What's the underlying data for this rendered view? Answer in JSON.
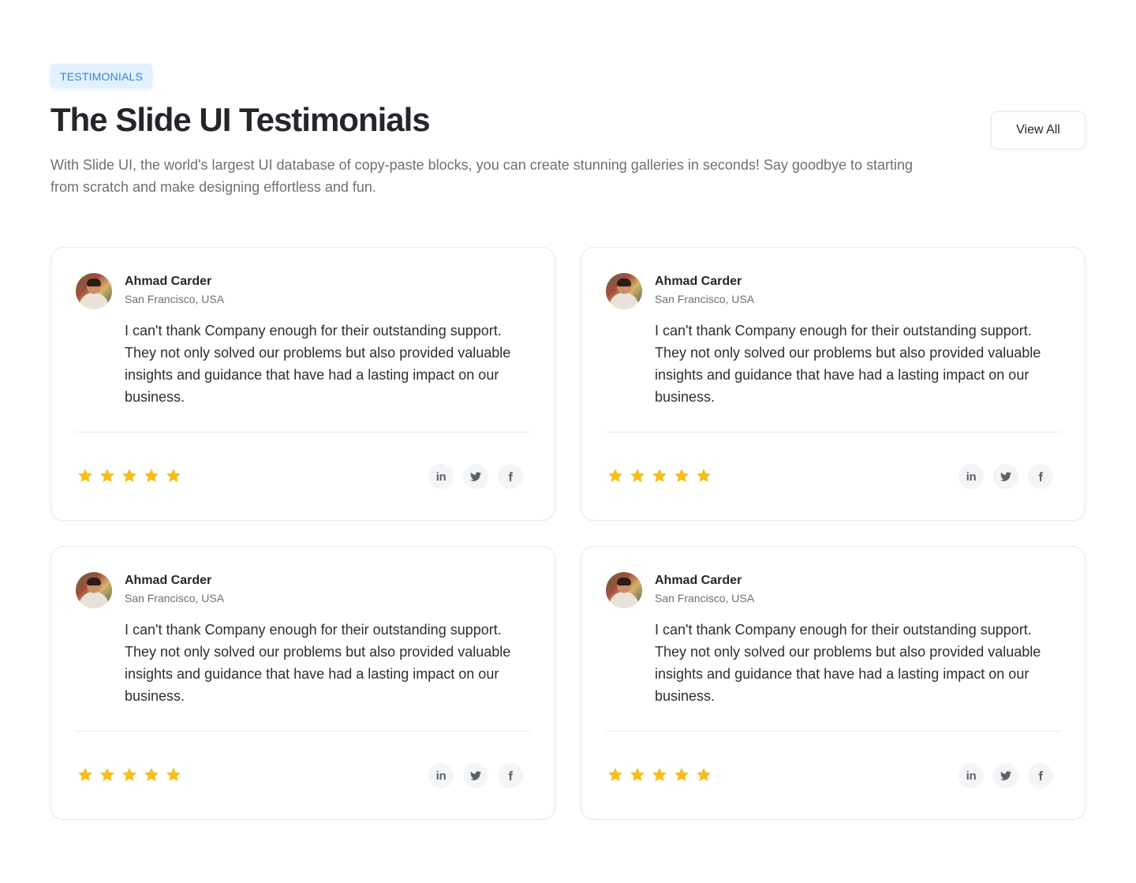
{
  "header": {
    "badge": "TESTIMONIALS",
    "title": "The Slide UI Testimonials",
    "subtitle": "With Slide UI, the world's largest UI database of copy-paste blocks, you can create stunning galleries in seconds! Say goodbye to starting from scratch and make designing effortless and fun.",
    "view_all_label": "View All"
  },
  "colors": {
    "badge_bg": "#e3f0fd",
    "badge_text": "#2f86d9",
    "star": "#f5be1b",
    "social_icon": "#5c6168"
  },
  "testimonials": [
    {
      "name": "Ahmad Carder",
      "location": "San Francisco, USA",
      "quote": "I can't thank Company enough for their outstanding support. They not only solved our problems but also provided valuable insights and guidance that have had a lasting impact on our business.",
      "rating": 5,
      "socials": [
        "linkedin-icon",
        "twitter-icon",
        "facebook-icon"
      ]
    },
    {
      "name": "Ahmad Carder",
      "location": "San Francisco, USA",
      "quote": "I can't thank Company enough for their outstanding support. They not only solved our problems but also provided valuable insights and guidance that have had a lasting impact on our business.",
      "rating": 5,
      "socials": [
        "linkedin-icon",
        "twitter-icon",
        "facebook-icon"
      ]
    },
    {
      "name": "Ahmad Carder",
      "location": "San Francisco, USA",
      "quote": "I can't thank Company enough for their outstanding support. They not only solved our problems but also provided valuable insights and guidance that have had a lasting impact on our business.",
      "rating": 5,
      "socials": [
        "linkedin-icon",
        "twitter-icon",
        "facebook-icon"
      ]
    },
    {
      "name": "Ahmad Carder",
      "location": "San Francisco, USA",
      "quote": "I can't thank Company enough for their outstanding support. They not only solved our problems but also provided valuable insights and guidance that have had a lasting impact on our business.",
      "rating": 5,
      "socials": [
        "linkedin-icon",
        "twitter-icon",
        "facebook-icon"
      ]
    }
  ]
}
